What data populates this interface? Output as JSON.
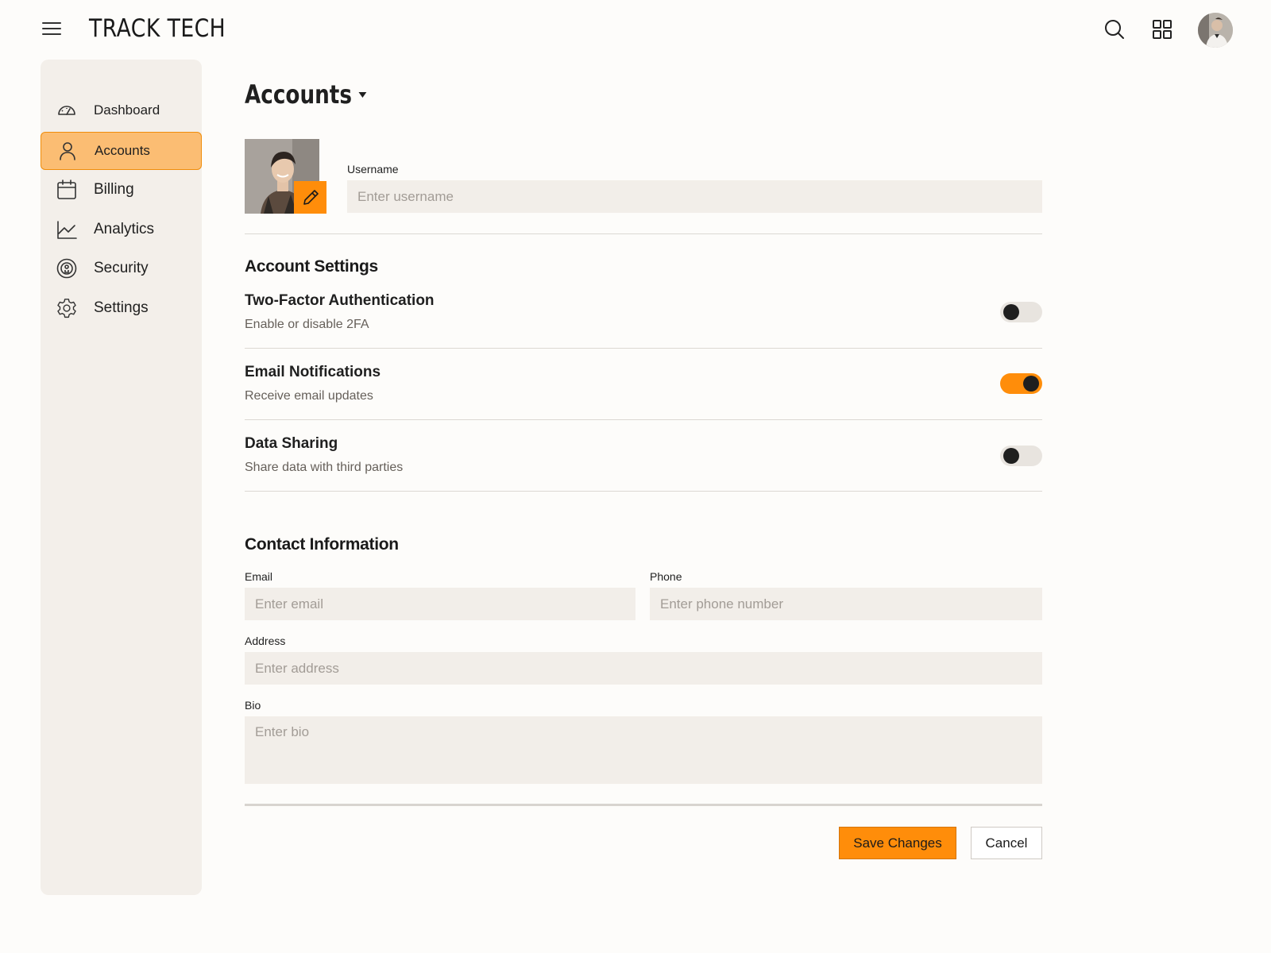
{
  "app": {
    "brand": "TRACK TECH"
  },
  "header": {
    "menu_icon": "hamburger-icon",
    "search_icon": "search-icon",
    "apps_icon": "grid-icon",
    "avatar_alt": "user-avatar"
  },
  "sidebar": {
    "items": [
      {
        "label": "Dashboard",
        "icon": "gauge-icon",
        "active": false
      },
      {
        "label": "Accounts",
        "icon": "user-icon",
        "active": true
      },
      {
        "label": "Billing",
        "icon": "calendar-icon",
        "active": false
      },
      {
        "label": "Analytics",
        "icon": "chart-line-icon",
        "active": false
      },
      {
        "label": "Security",
        "icon": "shield-icon",
        "active": false
      },
      {
        "label": "Settings",
        "icon": "gear-icon",
        "active": false
      }
    ]
  },
  "main": {
    "title": "Accounts",
    "profile": {
      "edit_icon": "pencil-icon",
      "username_label": "Username",
      "username_placeholder": "Enter username",
      "username_value": ""
    },
    "account_settings": {
      "title": "Account Settings",
      "items": [
        {
          "title": "Two-Factor Authentication",
          "description": "Enable or disable 2FA",
          "enabled": false
        },
        {
          "title": "Email Notifications",
          "description": "Receive email updates",
          "enabled": true
        },
        {
          "title": "Data Sharing",
          "description": "Share data with third parties",
          "enabled": false
        }
      ]
    },
    "contact": {
      "title": "Contact Information",
      "email_label": "Email",
      "email_placeholder": "Enter email",
      "phone_label": "Phone",
      "phone_placeholder": "Enter phone number",
      "address_label": "Address",
      "address_placeholder": "Enter address",
      "bio_label": "Bio",
      "bio_placeholder": "Enter bio"
    },
    "actions": {
      "save_label": "Save Changes",
      "cancel_label": "Cancel"
    }
  },
  "colors": {
    "accent": "#ff8d0a",
    "accent_light": "#fbbd73",
    "sidebar_bg": "#f3efea",
    "field_bg": "#f2eee9",
    "page_bg": "#fdfcfa"
  }
}
